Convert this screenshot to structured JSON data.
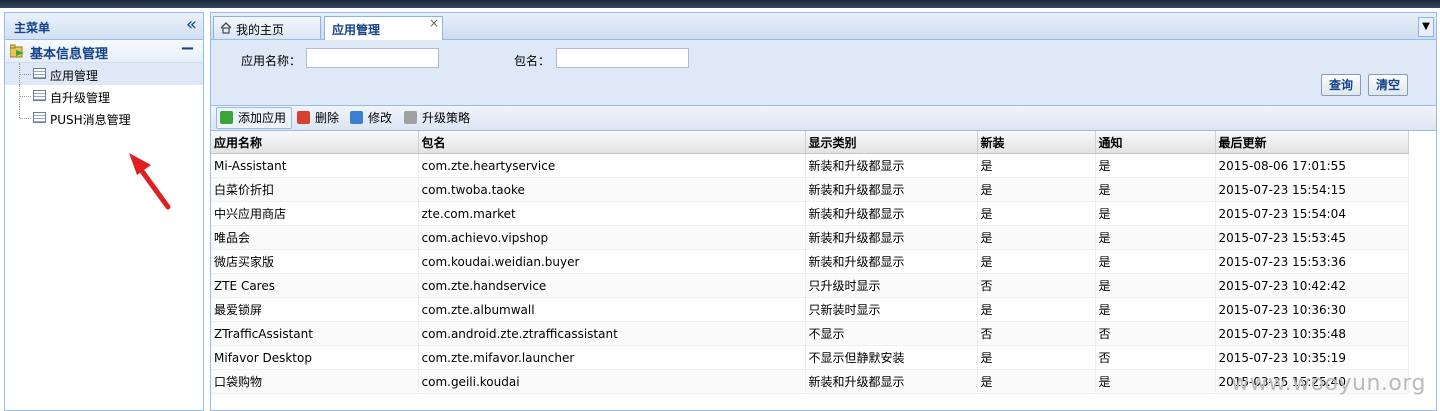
{
  "left_panel": {
    "title": "主菜单",
    "collapse_icon": "double-chevron-left-icon",
    "group": {
      "label": "基本信息管理",
      "toggle": "−"
    },
    "items": [
      {
        "label": "应用管理"
      },
      {
        "label": "自升级管理"
      },
      {
        "label": "PUSH消息管理"
      }
    ]
  },
  "tabs": {
    "home": "我的主页",
    "active": "应用管理",
    "close": "×"
  },
  "search": {
    "app_name_label": "应用名称：",
    "app_name_value": "",
    "package_label": "包名：",
    "package_value": "",
    "query_button": "查询",
    "clear_button": "清空"
  },
  "toolbar": {
    "add": "添加应用",
    "delete": "删除",
    "edit": "修改",
    "upgrade": "升级策略"
  },
  "colors": {
    "add_icon": "#3ba53b",
    "delete_icon": "#d9412f",
    "edit_icon": "#3a7fd0",
    "upgrade_icon": "#a0a0a0",
    "arrow": "#e02020"
  },
  "table": {
    "columns": [
      "应用名称",
      "包名",
      "显示类别",
      "新装",
      "通知",
      "最后更新"
    ],
    "rows": [
      [
        "Mi-Assistant",
        "com.zte.heartyservice",
        "新装和升级都显示",
        "是",
        "是",
        "2015-08-06 17:01:55"
      ],
      [
        "白菜价折扣",
        "com.twoba.taoke",
        "新装和升级都显示",
        "是",
        "是",
        "2015-07-23 15:54:15"
      ],
      [
        "中兴应用商店",
        "zte.com.market",
        "新装和升级都显示",
        "是",
        "是",
        "2015-07-23 15:54:04"
      ],
      [
        "唯品会",
        "com.achievo.vipshop",
        "新装和升级都显示",
        "是",
        "是",
        "2015-07-23 15:53:45"
      ],
      [
        "微店买家版",
        "com.koudai.weidian.buyer",
        "新装和升级都显示",
        "是",
        "是",
        "2015-07-23 15:53:36"
      ],
      [
        "ZTE Cares",
        "com.zte.handservice",
        "只升级时显示",
        "否",
        "是",
        "2015-07-23 10:42:42"
      ],
      [
        "最爱锁屏",
        "com.zte.albumwall",
        "只新装时显示",
        "是",
        "是",
        "2015-07-23 10:36:30"
      ],
      [
        "ZTrafficAssistant",
        "com.android.zte.ztrafficassistant",
        "不显示",
        "否",
        "否",
        "2015-07-23 10:35:48"
      ],
      [
        "Mifavor Desktop",
        "com.zte.mifavor.launcher",
        "不显示但静默安装",
        "是",
        "否",
        "2015-07-23 10:35:19"
      ],
      [
        "口袋购物",
        "com.geili.koudai",
        "新装和升级都显示",
        "是",
        "是",
        "2015-03-25 15:25:40"
      ]
    ]
  },
  "watermark": "www.wooyun.org"
}
